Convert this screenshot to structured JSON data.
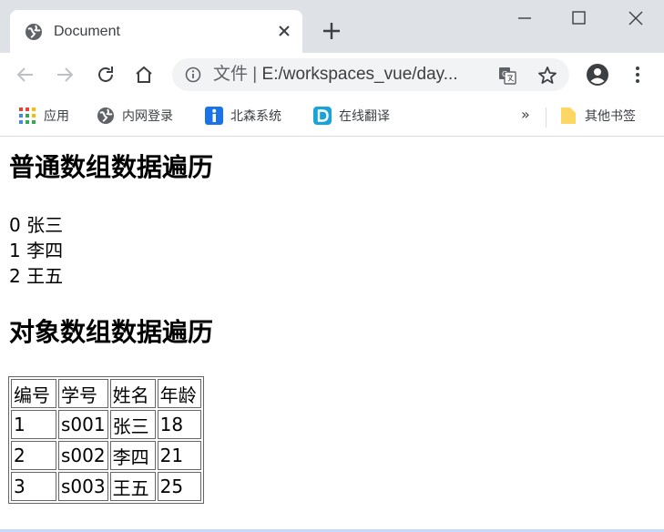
{
  "browser": {
    "tab_title": "Document",
    "address": {
      "scheme_label": "文件",
      "separator": "|",
      "url": "E:/workspaces_vue/day..."
    },
    "bookmarks": {
      "apps": "应用",
      "intranet": "内网登录",
      "beisen": "北森系统",
      "translate": "在线翻译",
      "more": "»",
      "other": "其他书签"
    },
    "icons": [
      "globe-icon",
      "close-icon",
      "plus-icon",
      "minimize-icon",
      "maximize-icon",
      "window-close-icon",
      "back-arrow-icon",
      "forward-arrow-icon",
      "reload-icon",
      "home-icon",
      "info-icon",
      "translate-icon",
      "star-icon",
      "profile-icon",
      "kebab-menu-icon",
      "apps-grid-icon",
      "folder-icon"
    ],
    "colors": {
      "tabstrip": "#dee1e6",
      "omnibox": "#f1f3f4",
      "beisen_icon": "#1a73e8",
      "translate_icon": "#1aa3d9",
      "folder": "#fdd663"
    }
  },
  "page": {
    "heading_array": "普通数组数据遍历",
    "array_items": [
      {
        "index": "0",
        "name": "张三"
      },
      {
        "index": "1",
        "name": "李四"
      },
      {
        "index": "2",
        "name": "王五"
      }
    ],
    "heading_objects": "对象数组数据遍历",
    "table": {
      "headers": [
        "编号",
        "学号",
        "姓名",
        "年龄"
      ],
      "rows": [
        [
          "1",
          "s001",
          "张三",
          "18"
        ],
        [
          "2",
          "s002",
          "李四",
          "21"
        ],
        [
          "3",
          "s003",
          "王五",
          "25"
        ]
      ]
    }
  }
}
